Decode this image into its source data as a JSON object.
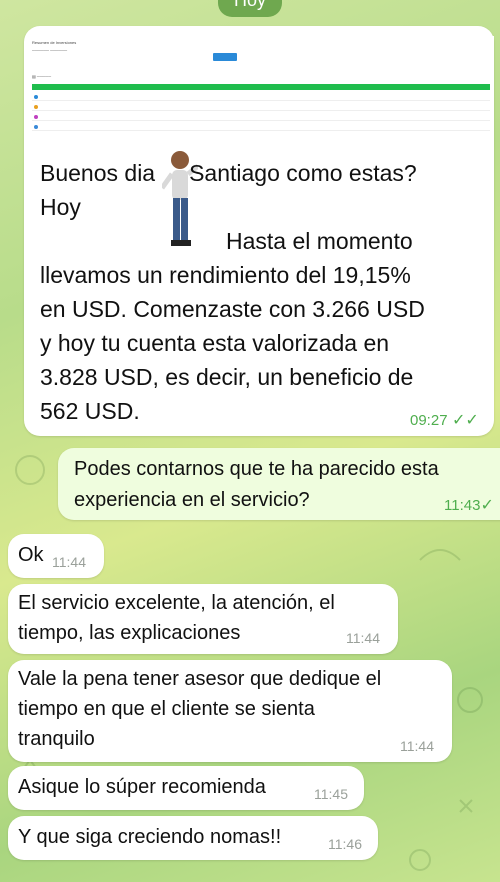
{
  "date_pill": "Hoy",
  "colors": {
    "bubble_in": "#ffffff",
    "bubble_out": "#effdde",
    "accent": "#4fae4e"
  },
  "first_message": {
    "line1": "Buenos dia",
    "line1b": "Santiago como estas?",
    "line2": "Hoy",
    "line3": "Hasta el momento",
    "line4": "llevamos un rendimiento del 19,15%",
    "line5": "en USD. Comenzaste con 3.266 USD",
    "line6": "y hoy tu cuenta esta valorizada en",
    "line7": "3.828 USD, es decir, un beneficio de",
    "line8": "562 USD.",
    "time": "09:27"
  },
  "embedded_screenshot": {
    "header": "Resumen de Inversiones",
    "button_label": "Consultar"
  },
  "outgoing": {
    "line1": "Podes contarnos que te ha parecido esta",
    "line2": "experiencia en el servicio?",
    "time": "11:43"
  },
  "messages": [
    {
      "lines": [
        "Ok"
      ],
      "time": "11:44"
    },
    {
      "lines": [
        "El servicio excelente, la atención, el",
        "tiempo, las explicaciones"
      ],
      "time": "11:44"
    },
    {
      "lines": [
        "Vale la pena tener asesor que dedique el",
        "tiempo en que el cliente se sienta",
        "tranquilo"
      ],
      "time": "11:44"
    },
    {
      "lines": [
        "Asique lo súper recomienda"
      ],
      "time": "11:45"
    },
    {
      "lines": [
        "Y que siga creciendo nomas!!"
      ],
      "time": "11:46"
    }
  ]
}
